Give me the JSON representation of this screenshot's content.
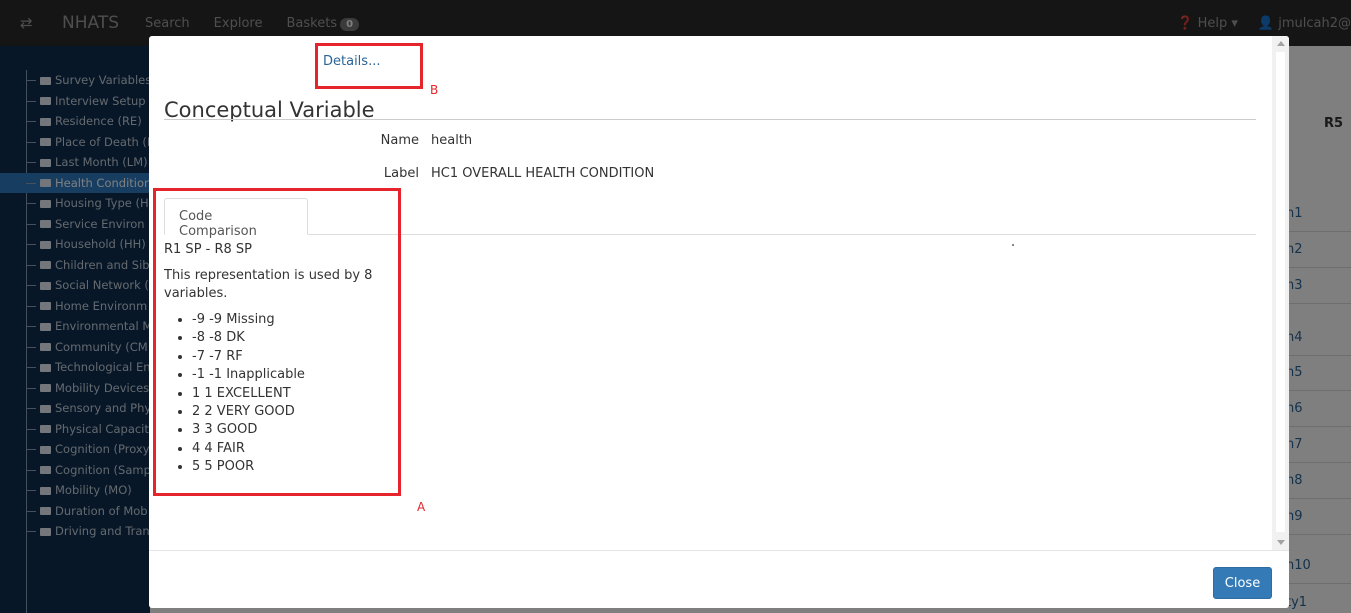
{
  "navbar": {
    "toggle_icon": "swap-icon",
    "brand": "NHATS",
    "links": [
      "Search",
      "Explore",
      "Baskets"
    ],
    "basket_count": "0",
    "help": "Help ▾",
    "user": "jmulcah2@"
  },
  "sidebar": {
    "items": [
      "Survey Variables",
      "Interview Setup",
      "Residence (RE)",
      "Place of Death (P",
      "Last Month (LM)",
      "Health Condition",
      "Housing Type (H",
      "Service Environ",
      "Household (HH)",
      "Children and Sibl",
      "Social Network (",
      "Home Environm",
      "Environmental M",
      "Community (CM",
      "Technological En",
      "Mobility Devices",
      "Sensory and Phy",
      "Physical Capacit",
      "Cognition (Proxy",
      "Cognition (Samp",
      "Mobility (MO)",
      "Duration of Mob",
      "Driving and Tran"
    ],
    "active_index": 5
  },
  "right_strip": {
    "header": "R5",
    "items": [
      "n1",
      "n2",
      "n3",
      "n4",
      "n5",
      "n6",
      "n7",
      "n8",
      "n9",
      "n10",
      "ty1"
    ]
  },
  "modal": {
    "details_link": "Details...",
    "title": "Conceptual Variable",
    "name_label": "Name",
    "name_value": "health",
    "label_label": "Label",
    "label_value": "HC1 OVERALL HEALTH CONDITION",
    "tab_label": "Code Comparison",
    "range": "R1 SP - R8 SP",
    "usage": "This representation is used by 8 variables.",
    "codes": [
      "-9 -9 Missing",
      "-8 -8 DK",
      "-7 -7 RF",
      "-1 -1 Inapplicable",
      "1 1 EXCELLENT",
      "2 2 VERY GOOD",
      "3 3 GOOD",
      "4 4 FAIR",
      "5 5 POOR"
    ],
    "close_label": "Close"
  },
  "annotations": {
    "a": "A",
    "b": "B",
    "color": "#e5242b"
  }
}
